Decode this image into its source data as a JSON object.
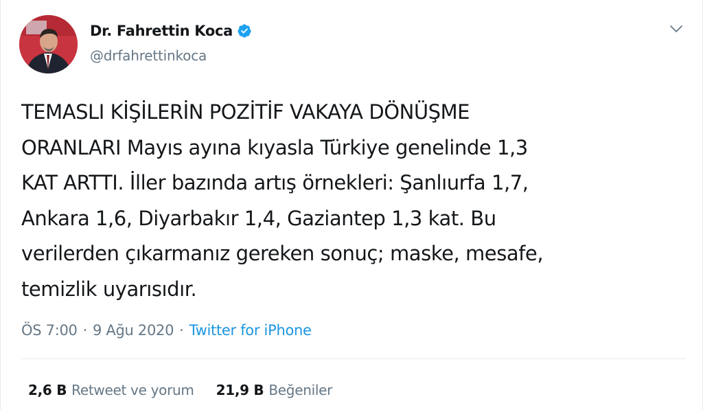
{
  "author": {
    "display_name": "Dr. Fahrettin Koca",
    "handle": "@drfahrettinkoca",
    "verified": true
  },
  "tweet": {
    "text": "TEMASLI KİŞİLERİN POZİTİF VAKAYA DÖNÜŞME\nORANLARI Mayıs ayına kıyasla Türkiye genelinde 1,3\nKAT ARTTI. İller bazında artış örnekleri: Şanlıurfa 1,7,\nAnkara 1,6, Diyarbakır 1,4, Gaziantep 1,3 kat. Bu\nverilerden çıkarmanız gereken sonuç; maske, mesafe,\ntemizlik uyarısıdır.",
    "time": "ÖS 7:00",
    "separator": "·",
    "date": "9 Ağu 2020",
    "source": "Twitter for iPhone"
  },
  "stats": {
    "retweets_count": "2,6 B",
    "retweets_label": "Retweet ve yorum",
    "likes_count": "21,9 B",
    "likes_label": "Beğeniler"
  },
  "icons": {
    "verified": "verified-badge-icon",
    "caret": "chevron-down-icon"
  },
  "colors": {
    "verified_blue": "#1da1f2",
    "link_blue": "#1b95e0",
    "secondary_text": "#657786",
    "primary_text": "#14171a",
    "divider": "#e6ecf0"
  }
}
